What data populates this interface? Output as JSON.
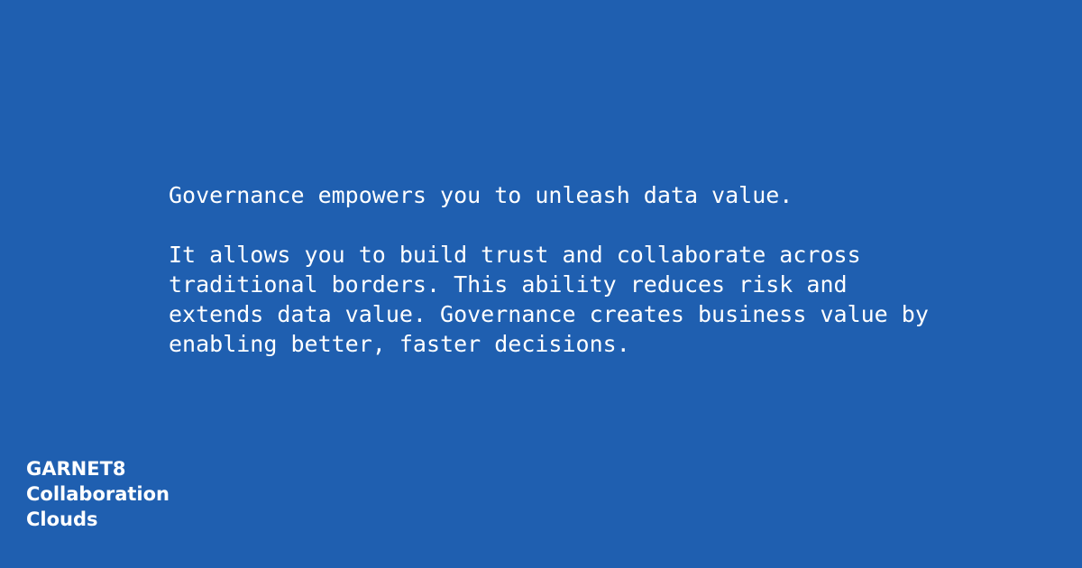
{
  "colors": {
    "background": "#1f5fb0",
    "text": "#ffffff"
  },
  "message": {
    "headline": "Governance empowers you to unleash data value.",
    "body_lines": [
      "It allows you to build trust and collaborate across",
      "traditional borders. This ability reduces risk and",
      "extends data value. Governance creates business value by",
      "enabling better, faster decisions."
    ]
  },
  "brand": {
    "lines": [
      "GARNET8",
      "Collaboration",
      "Clouds"
    ]
  }
}
